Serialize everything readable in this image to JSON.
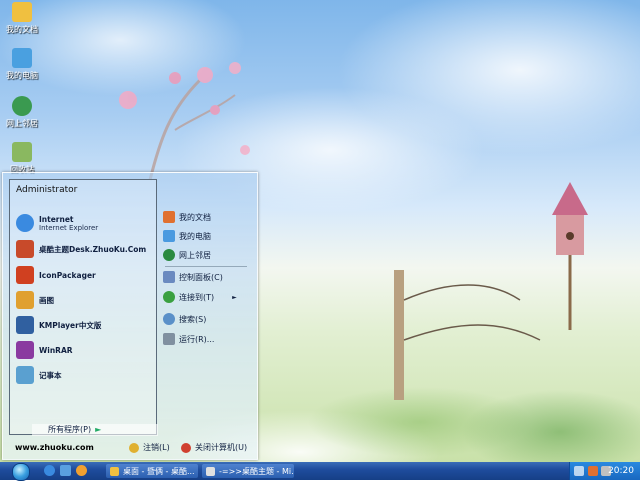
{
  "desktop": {
    "icons": [
      {
        "label": "我的文档",
        "color": "#f0c040"
      },
      {
        "label": "我的电脑",
        "color": "#4aa0e0"
      },
      {
        "label": "网上邻居",
        "color": "#3a9a50"
      },
      {
        "label": "回收站",
        "color": "#8ab860"
      }
    ]
  },
  "start_menu": {
    "user": "Administrator",
    "left_items": [
      {
        "title": "Internet",
        "subtitle": "Internet Explorer",
        "icon": "internet-explorer-icon",
        "color": "#3a8ae0"
      },
      {
        "title": "桌酷主题Desk.ZhuoKu.Com",
        "subtitle": "",
        "icon": "zhuoku-icon",
        "color": "#c84a2a"
      },
      {
        "title": "IconPackager",
        "subtitle": "",
        "icon": "iconpackager-icon",
        "color": "#d04020"
      },
      {
        "title": "画图",
        "subtitle": "",
        "icon": "paint-icon",
        "color": "#e0a030"
      },
      {
        "title": "KMPlayer中文版",
        "subtitle": "",
        "icon": "kmplayer-icon",
        "color": "#3060a0"
      },
      {
        "title": "WinRAR",
        "subtitle": "",
        "icon": "winrar-icon",
        "color": "#8a3aa0"
      },
      {
        "title": "记事本",
        "subtitle": "",
        "icon": "notepad-icon",
        "color": "#5aa0d0"
      }
    ],
    "all_programs": "所有程序(P)",
    "right_items": [
      {
        "label": "我的文档",
        "icon": "my-documents-icon",
        "color": "#e07030"
      },
      {
        "label": "我的电脑",
        "icon": "my-computer-icon",
        "color": "#4a9ae0"
      },
      {
        "label": "网上邻居",
        "icon": "network-icon",
        "color": "#2a8a40"
      },
      {
        "label": "控制面板(C)",
        "icon": "control-panel-icon",
        "color": "#6a8ac0"
      },
      {
        "label": "连接到(T)",
        "icon": "connect-icon",
        "color": "#3aa040"
      },
      {
        "label": "搜索(S)",
        "icon": "search-icon",
        "color": "#5a90c8"
      },
      {
        "label": "运行(R)...",
        "icon": "run-icon",
        "color": "#8090a0"
      }
    ],
    "footer": {
      "site": "www.zhuoku.com",
      "logoff": "注销(L)",
      "shutdown": "关闭计算机(U)"
    }
  },
  "taskbar": {
    "tasks": [
      {
        "label": "桌面 - 暨俩 - 桌酷...",
        "color": "#f0c040"
      },
      {
        "label": "-=>>桌酷主题 - Mi...",
        "color": "#e0e0e0"
      }
    ],
    "clock": "20:20",
    "colors": {
      "bar": "#1f4d9e",
      "tray": "#1968c0"
    }
  }
}
